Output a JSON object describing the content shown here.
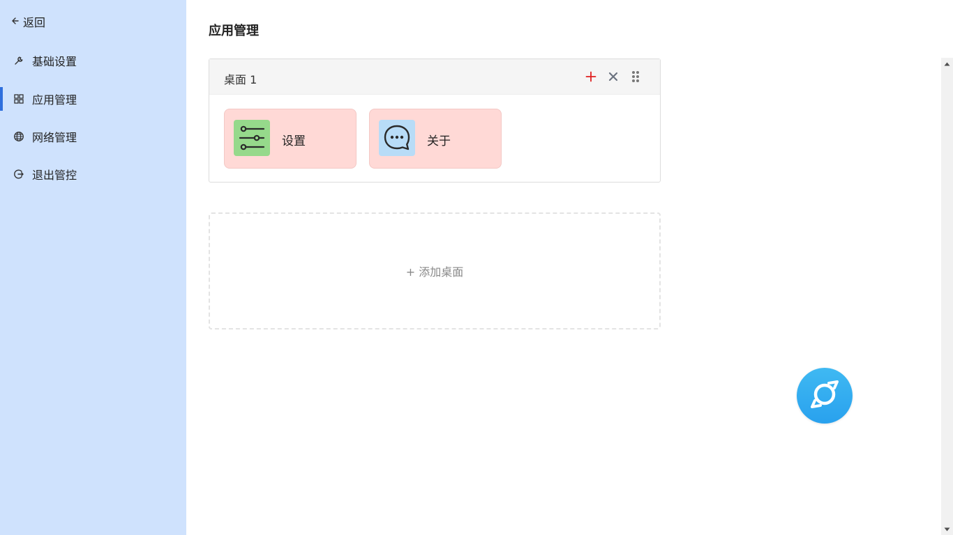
{
  "sidebar": {
    "back_label": "返回",
    "items": [
      {
        "label": "基础设置",
        "icon": "wrench-icon"
      },
      {
        "label": "应用管理",
        "icon": "grid-icon",
        "active": true
      },
      {
        "label": "网络管理",
        "icon": "globe-icon"
      },
      {
        "label": "退出管控",
        "icon": "logout-icon"
      }
    ]
  },
  "main": {
    "title": "应用管理",
    "desktop": {
      "title": "桌面 1",
      "actions": {
        "add": "plus-icon",
        "delete": "close-icon",
        "drag": "drag-handle-icon"
      },
      "apps": [
        {
          "label": "设置",
          "icon": "sliders-icon",
          "icon_bg": "#96d98b"
        },
        {
          "label": "关于",
          "icon": "chat-bubble-icon",
          "icon_bg": "#b8dcf7"
        }
      ]
    },
    "add_desktop_label": "+ 添加桌面"
  },
  "colors": {
    "sidebar_bg": "#cfe2fd",
    "active_accent": "#2f6fdd",
    "card_bg": "#ffd9d6",
    "add_red": "#e02020",
    "fab_blue": "#2ea8f0"
  }
}
